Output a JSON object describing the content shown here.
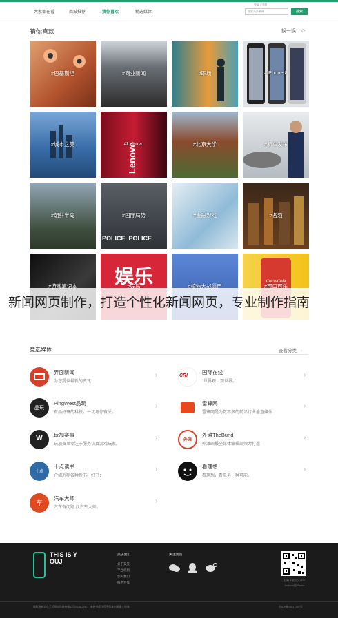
{
  "topnav": {
    "items": [
      "大家都在看",
      "商城推荐",
      "猜你喜欢",
      "精选媒体"
    ],
    "active_index": 2,
    "login": "登录 | 注册",
    "search_placeholder": "搜索头条新闻",
    "search_button": "搜索"
  },
  "guess": {
    "title": "猜你喜欢",
    "refresh_label": "换一换",
    "tiles": [
      {
        "tag": "#巴基斯坦",
        "color": "#c2734b"
      },
      {
        "tag": "#商业新闻",
        "color": "#3d3d3d"
      },
      {
        "tag": "#职场",
        "color": "#3a8aa0"
      },
      {
        "tag": "#iPhone 8",
        "color": "#7f8c96"
      },
      {
        "tag": "#城市之美",
        "color": "#3d6aa8"
      },
      {
        "tag": "#Lenovo",
        "color": "#b7152c"
      },
      {
        "tag": "#北京大学",
        "color": "#6c7d4a"
      },
      {
        "tag": "#新车发布",
        "color": "#9aa3ad"
      },
      {
        "tag": "#朝鲜半岛",
        "color": "#3c5568"
      },
      {
        "tag": "#国际局势",
        "color": "#45494f"
      },
      {
        "tag": "#金融游戏",
        "color": "#7db2d4"
      },
      {
        "tag": "#名酒",
        "color": "#5b3a22"
      },
      {
        "tag": "#游戏笔记本",
        "color": "#1c1c1c"
      },
      {
        "tag": "#娱乐",
        "color": "#d62638"
      },
      {
        "tag": "#植物大战僵尸",
        "color": "#4a74c0"
      },
      {
        "tag": "#可口可乐",
        "color": "#d63a2e"
      }
    ],
    "tile_big_text": "娱乐",
    "tile_brand_lenovo": "Lenovo",
    "tile_brand_cola": "Coca-Cola"
  },
  "caption": "新闻网页制作，打造个性化新闻网页，专业制作指南",
  "media": {
    "title": "竞选媒体",
    "more_label": "查看分类",
    "items": [
      {
        "name": "界面新闻",
        "desc": "为您提供最新的资讯",
        "logo_text": "界",
        "color": "#d6402b"
      },
      {
        "name": "国际在线",
        "desc": "“世界观，观世界。”",
        "logo_text": "CRI",
        "color": "#ffffff"
      },
      {
        "name": "PingWest品玩",
        "desc": "有品好玩的科技，一切与你有关。",
        "logo_text": "品玩",
        "color": "#222222"
      },
      {
        "name": "雷锋网",
        "desc": "雷锋网是为数不多的前沿行业垂直媒体",
        "logo_text": "雷",
        "color": "#e8481b"
      },
      {
        "name": "玩加赛事",
        "desc": "玩加赛事专注于服务认真游戏玩家。",
        "logo_text": "W",
        "color": "#222222"
      },
      {
        "name": "外滩TheBund",
        "desc": "外滩画报全媒体编辑部倾力打造",
        "logo_text": "外滩",
        "color": "#ffffff"
      },
      {
        "name": "十点读书",
        "desc": "介绍近期各种新书、好书；",
        "logo_text": "十点",
        "color": "#2f6aa6"
      },
      {
        "name": "看理想",
        "desc": "看理想，看见另一种可能。",
        "logo_text": "看",
        "color": "#111111"
      },
      {
        "name": "汽车大师",
        "desc": "汽车有问题 找汽车大师。",
        "logo_text": "车",
        "color": "#e04a1f"
      }
    ]
  },
  "footer": {
    "logo_text": "THIS IS YOUJ",
    "about_title": "关于我们",
    "about_links": [
      "关于又又",
      "平台规则",
      "加入我们",
      "服务合作"
    ],
    "follow_title": "关注我们",
    "app_text": "扫码下载又又APP",
    "app_sub": "Android及iPhone",
    "copyright": "版权所有北京又又网络科技有限公司2016-2017，未经书面许可不得复制或建立镜像",
    "icp": "京ICP备16017557号"
  }
}
